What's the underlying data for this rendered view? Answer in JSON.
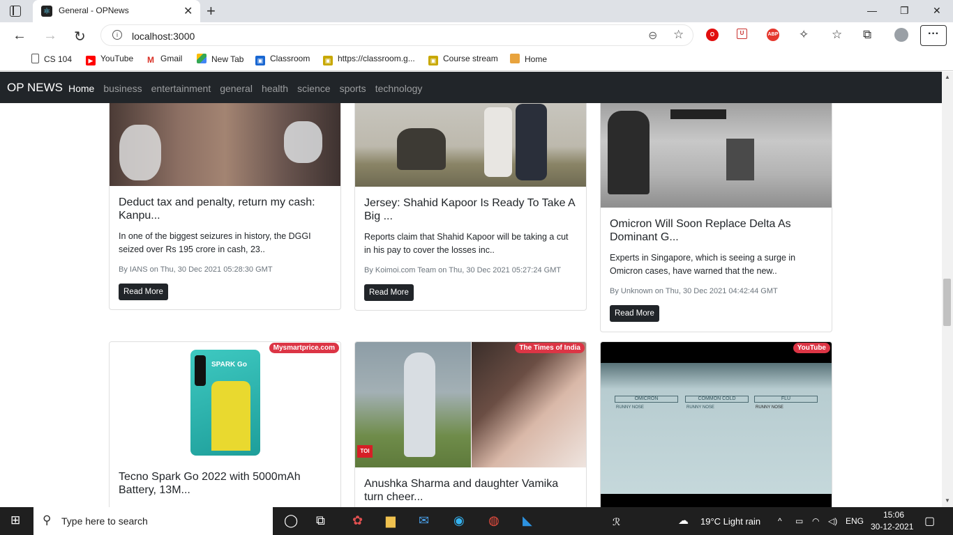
{
  "browser": {
    "tab_title": "General - OPNews",
    "url": "localhost:3000",
    "bookmarks": [
      {
        "label": "CS 104",
        "icon": "page-icon",
        "color": "#555"
      },
      {
        "label": "YouTube",
        "icon": "youtube-icon",
        "color": "#ff0000"
      },
      {
        "label": "Gmail",
        "icon": "gmail-icon",
        "color": "#d93025"
      },
      {
        "label": "New Tab",
        "icon": "drive-icon",
        "color": "#34a853"
      },
      {
        "label": "Classroom",
        "icon": "classroom-icon",
        "color": "#1967d2"
      },
      {
        "label": "https://classroom.g...",
        "icon": "classroom-icon",
        "color": "#f9ab00"
      },
      {
        "label": "Course stream",
        "icon": "classroom-icon",
        "color": "#f9ab00"
      },
      {
        "label": "Home",
        "icon": "box-icon",
        "color": "#e8a33d"
      }
    ],
    "extensions": [
      {
        "name": "opera-icon",
        "text": "O",
        "color": "#e10e0e"
      },
      {
        "name": "shield-icon",
        "text": "U",
        "color": "#c9302c"
      },
      {
        "name": "adblock-icon",
        "text": "ABP",
        "color": "#e5372d"
      }
    ]
  },
  "app": {
    "brand": "OP NEWS",
    "nav": [
      "Home",
      "business",
      "entertainment",
      "general",
      "health",
      "science",
      "sports",
      "technology"
    ]
  },
  "cards": [
    {
      "title": "Deduct tax and penalty, return my cash: Kanpu...",
      "desc": "In one of the biggest seizures in history, the DGGI seized over Rs 195 crore in cash, 23..",
      "meta": "By IANS on Thu, 30 Dec 2021 05:28:30 GMT",
      "button": "Read More"
    },
    {
      "title": "Jersey: Shahid Kapoor Is Ready To Take A Big ...",
      "desc": "Reports claim that Shahid Kapoor will be taking a cut in his pay to cover the losses inc..",
      "meta": "By Koimoi.com Team on Thu, 30 Dec 2021 05:27:24 GMT",
      "button": "Read More"
    },
    {
      "title": "Omicron Will Soon Replace Delta As Dominant G...",
      "desc": "Experts in Singapore, which is seeing a surge in Omicron cases, have warned that the new..",
      "meta": "By Unknown on Thu, 30 Dec 2021 04:42:44 GMT",
      "button": "Read More"
    },
    {
      "badge": "Mysmartprice.com",
      "title": "Tecno Spark Go 2022 with 5000mAh Battery, 13M...",
      "phone_brand": "SPARK Go"
    },
    {
      "badge": "The Times of India",
      "title": "Anushka Sharma and daughter Vamika turn cheer...",
      "logo": "TOI"
    },
    {
      "badge": "YouTube",
      "labels": [
        "OMICRON",
        "COMMON COLD",
        "FLU"
      ],
      "sublabels": [
        "RUNNY NOSE",
        "RUNNY NOSE",
        "RUNNY NOSE"
      ]
    }
  ],
  "taskbar": {
    "search_placeholder": "Type here to search",
    "weather": "19°C  Light rain",
    "lang": "ENG",
    "time": "15:06",
    "date": "30-12-2021"
  }
}
